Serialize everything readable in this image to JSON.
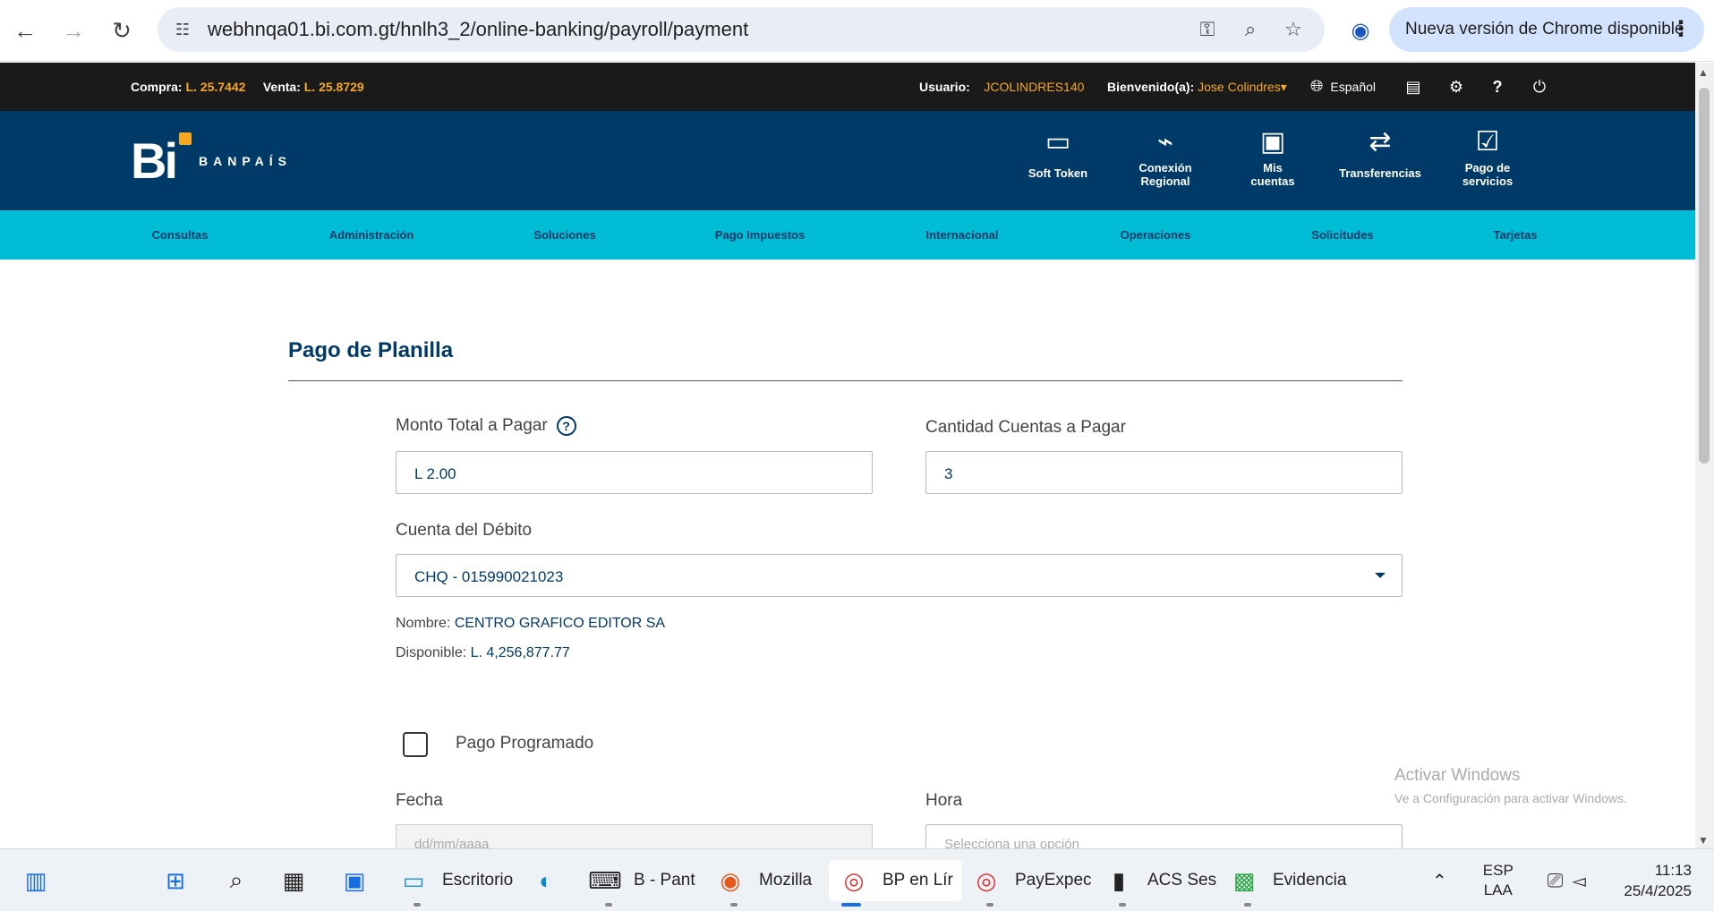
{
  "browser": {
    "url": "webhnqa01.bi.com.gt/hnlh3_2/online-banking/payroll/payment",
    "update_label": "Nueva versión de Chrome disponible"
  },
  "topbar": {
    "compra_label": "Compra:",
    "compra_value": "L. 25.7442",
    "venta_label": "Venta:",
    "venta_value": "L. 25.8729",
    "usuario_label": "Usuario:",
    "usuario_value": "JCOLINDRES140",
    "bienvenido_label": "Bienvenido(a):",
    "bienvenido_value": "Jose Colindres",
    "language": "Español"
  },
  "header": {
    "logo_text": "Bi",
    "brand": "BANPAÍS",
    "menu": [
      {
        "l1": "Soft Token",
        "l2": "",
        "icon": "token-icon"
      },
      {
        "l1": "Conexión",
        "l2": "Regional",
        "icon": "regional-icon"
      },
      {
        "l1": "Mis",
        "l2": "cuentas",
        "icon": "wallet-icon"
      },
      {
        "l1": "Transferencias",
        "l2": "",
        "icon": "transfer-icon"
      },
      {
        "l1": "Pago de",
        "l2": "servicios",
        "icon": "services-icon"
      }
    ]
  },
  "nav": [
    "Consultas",
    "Administración",
    "Soluciones",
    "Pago Impuestos",
    "Internacional",
    "Operaciones",
    "Solicitudes",
    "Tarjetas"
  ],
  "form": {
    "title": "Pago de Planilla",
    "monto_label": "Monto Total a Pagar",
    "monto_value": "L 2.00",
    "cantidad_label": "Cantidad Cuentas a Pagar",
    "cantidad_value": "3",
    "cuenta_label": "Cuenta del Débito",
    "cuenta_value": "CHQ - 015990021023",
    "nombre_label": "Nombre:",
    "nombre_value": "CENTRO GRAFICO EDITOR SA",
    "disponible_label": "Disponible:",
    "disponible_value": "L. 4,256,877.77",
    "programado_label": "Pago Programado",
    "fecha_label": "Fecha",
    "fecha_placeholder": "dd/mm/aaaa",
    "hora_label": "Hora",
    "hora_placeholder": "Selecciona una opción"
  },
  "watermark": {
    "title": "Activar Windows",
    "subtitle": "Ve a Configuración para activar Windows."
  },
  "taskbar": {
    "apps": [
      "Escritorio",
      "B - Pant",
      "Mozilla",
      "BP en Lír",
      "PayExpec",
      "ACS Ses",
      "Evidencia"
    ],
    "lang1": "ESP",
    "lang2": "LAA",
    "time": "11:13",
    "date": "25/4/2025"
  }
}
